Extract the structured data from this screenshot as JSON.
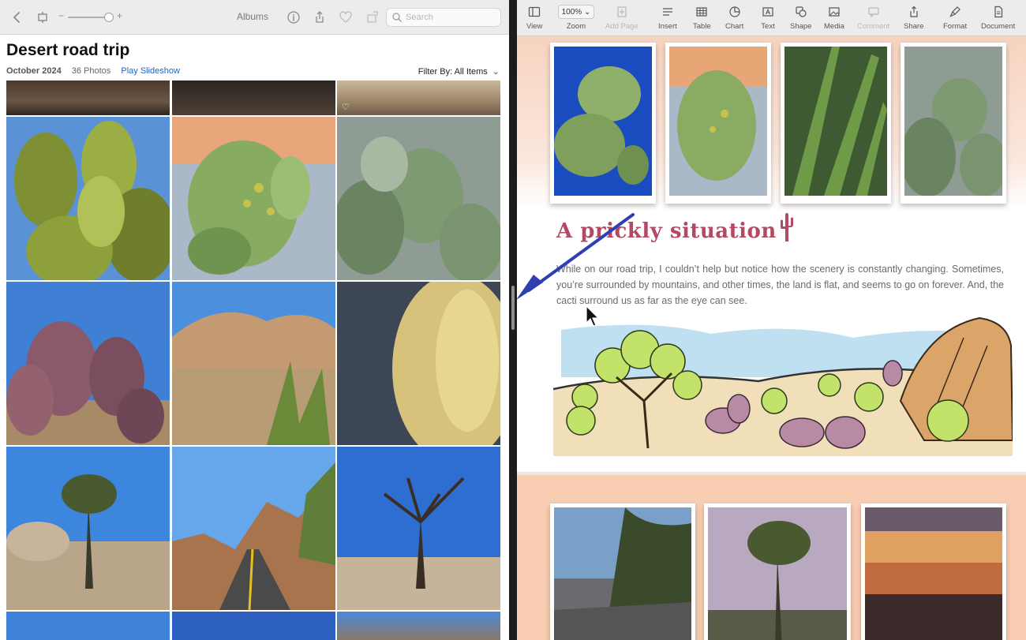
{
  "photos_app": {
    "toolbar": {
      "albums_label": "Albums",
      "search_placeholder": "Search"
    },
    "album": {
      "title": "Desert road trip",
      "date": "October 2024",
      "photo_count": "36 Photos",
      "slideshow_label": "Play Slideshow",
      "filter_label": "Filter By: All Items"
    }
  },
  "pages_app": {
    "toolbar": {
      "view": "View",
      "zoom_value": "100%",
      "zoom": "Zoom",
      "add_page": "Add Page",
      "insert": "Insert",
      "table": "Table",
      "chart": "Chart",
      "text": "Text",
      "shape": "Shape",
      "media": "Media",
      "comment": "Comment",
      "share": "Share",
      "format": "Format",
      "document": "Document"
    },
    "document": {
      "heading": "A prickly situation",
      "body": "While on our road trip, I couldn’t help but notice how the scenery is constantly changing. Sometimes, you’re surrounded by mountains, and other times, the land is flat, and seems to go on forever. And, the cacti surround us as far as the eye can see."
    }
  },
  "colors": {
    "heading": "#b24a63",
    "link": "#1a64c8",
    "page_background": "#f9cdb2",
    "annotation_arrow": "#2f3fb0"
  }
}
